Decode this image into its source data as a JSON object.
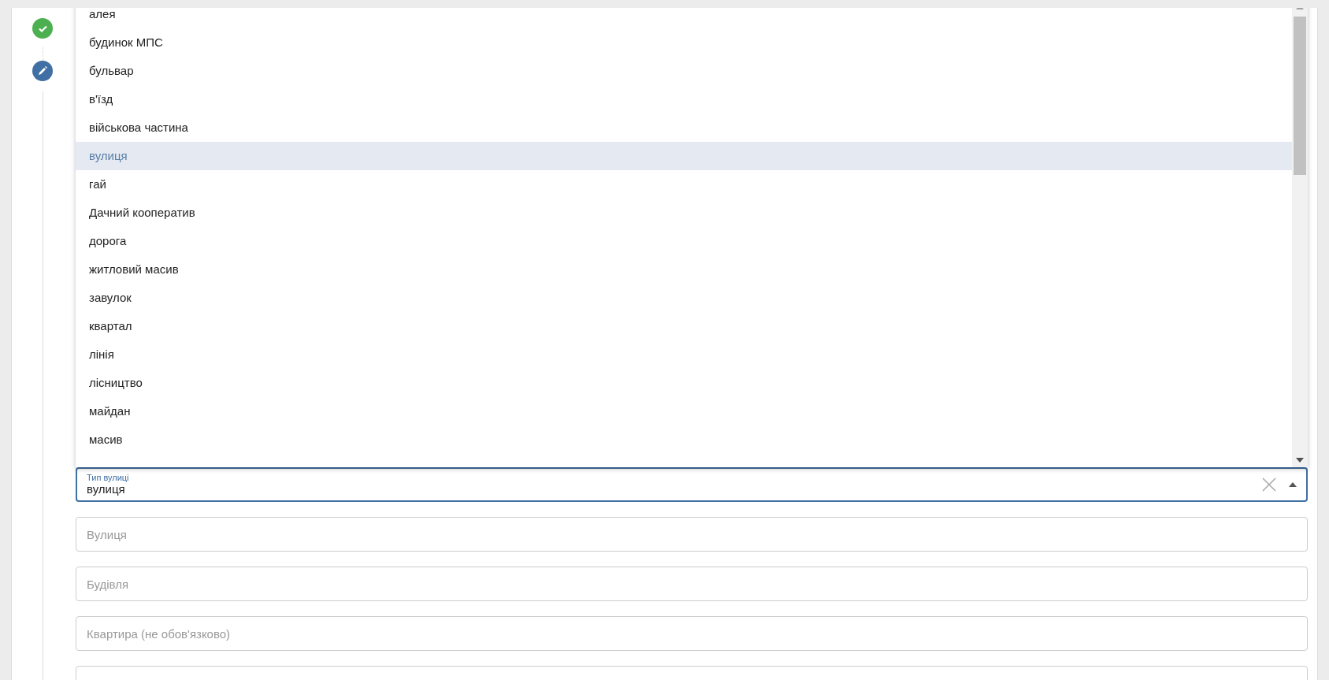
{
  "steps": [
    {
      "completed": true
    },
    {
      "completed": false
    }
  ],
  "street_type": {
    "label": "Тип вулиці",
    "value": "вулиця",
    "expanded": true,
    "options": [
      {
        "label": "алея",
        "selected": false
      },
      {
        "label": "будинок МПС",
        "selected": false
      },
      {
        "label": "бульвар",
        "selected": false
      },
      {
        "label": "в'їзд",
        "selected": false
      },
      {
        "label": "військова частина",
        "selected": false
      },
      {
        "label": "вулиця",
        "selected": true
      },
      {
        "label": "гай",
        "selected": false
      },
      {
        "label": "Дачний кооператив",
        "selected": false
      },
      {
        "label": "дорога",
        "selected": false
      },
      {
        "label": "житловий масив",
        "selected": false
      },
      {
        "label": "завулок",
        "selected": false
      },
      {
        "label": "квартал",
        "selected": false
      },
      {
        "label": "лінія",
        "selected": false
      },
      {
        "label": "лісництво",
        "selected": false
      },
      {
        "label": "майдан",
        "selected": false
      },
      {
        "label": "масив",
        "selected": false
      }
    ]
  },
  "fields": [
    {
      "kind": "text",
      "placeholder": "Вулиця"
    },
    {
      "kind": "text",
      "placeholder": "Будівля"
    },
    {
      "kind": "text",
      "placeholder": "Квартира (не обов'язково)"
    },
    {
      "kind": "text"
    }
  ]
}
